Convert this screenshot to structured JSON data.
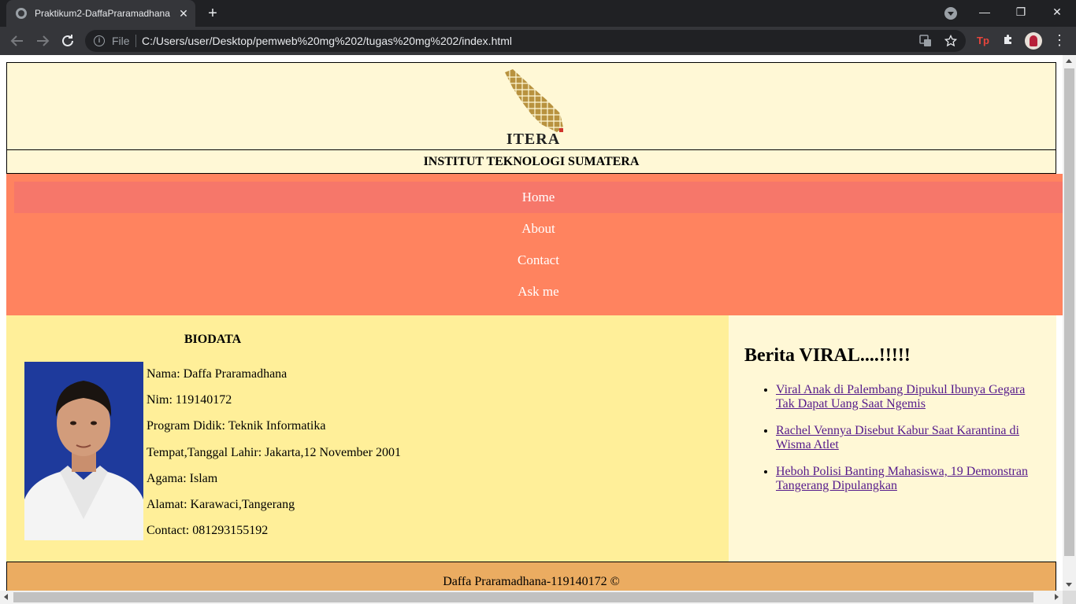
{
  "browser": {
    "tab_title": "Praktikum2-DaffaPraramadhana-",
    "tab_close": "✕",
    "new_tab": "+",
    "scheme_label": "File",
    "url": "C:/Users/user/Desktop/pemweb%20mg%202/tugas%20mg%202/index.html",
    "window_controls": {
      "minimize": "—",
      "restore": "❐",
      "close": "✕"
    }
  },
  "site": {
    "logo_text": "ITERA",
    "institute_name": "INSTITUT TEKNOLOGI SUMATERA",
    "nav": [
      {
        "label": "Home",
        "active": true
      },
      {
        "label": "About",
        "active": false
      },
      {
        "label": "Contact",
        "active": false
      },
      {
        "label": "Ask me",
        "active": false
      }
    ],
    "biodata": {
      "title": "BIODATA",
      "fields": [
        "Nama: Daffa Praramadhana",
        "Nim: 119140172",
        "Program Didik: Teknik Informatika",
        "Tempat,Tanggal Lahir: Jakarta,12 November 2001",
        "Agama: Islam",
        "Alamat: Karawaci,Tangerang",
        "Contact: 081293155192"
      ]
    },
    "news": {
      "title": "Berita VIRAL....!!!!!",
      "items": [
        "Viral Anak di Palembang Dipukul Ibunya Gegara Tak Dapat Uang Saat Ngemis",
        "Rachel Vennya Disebut Kabur Saat Karantina di Wisma Atlet",
        "Heboh Polisi Banting Mahasiswa, 19 Demonstran Tangerang Dipulangkan"
      ]
    },
    "footer": "Daffa Praramadhana-119140172 ©"
  },
  "colors": {
    "header_bg": "#fff8d6",
    "nav_bg": "#ff835f",
    "nav_active_bg": "#f6776a",
    "main_bg": "#ffef99",
    "footer_bg": "#ebac61",
    "link": "#551a8b"
  },
  "icons": [
    "globe-favicon-icon",
    "tab-search-icon",
    "back-arrow-icon",
    "forward-arrow-icon",
    "reload-icon",
    "info-icon",
    "translate-icon",
    "star-icon",
    "extension-tp-icon",
    "puzzle-extensions-icon",
    "profile-avatar",
    "menu-dots-icon",
    "itera-logo"
  ]
}
